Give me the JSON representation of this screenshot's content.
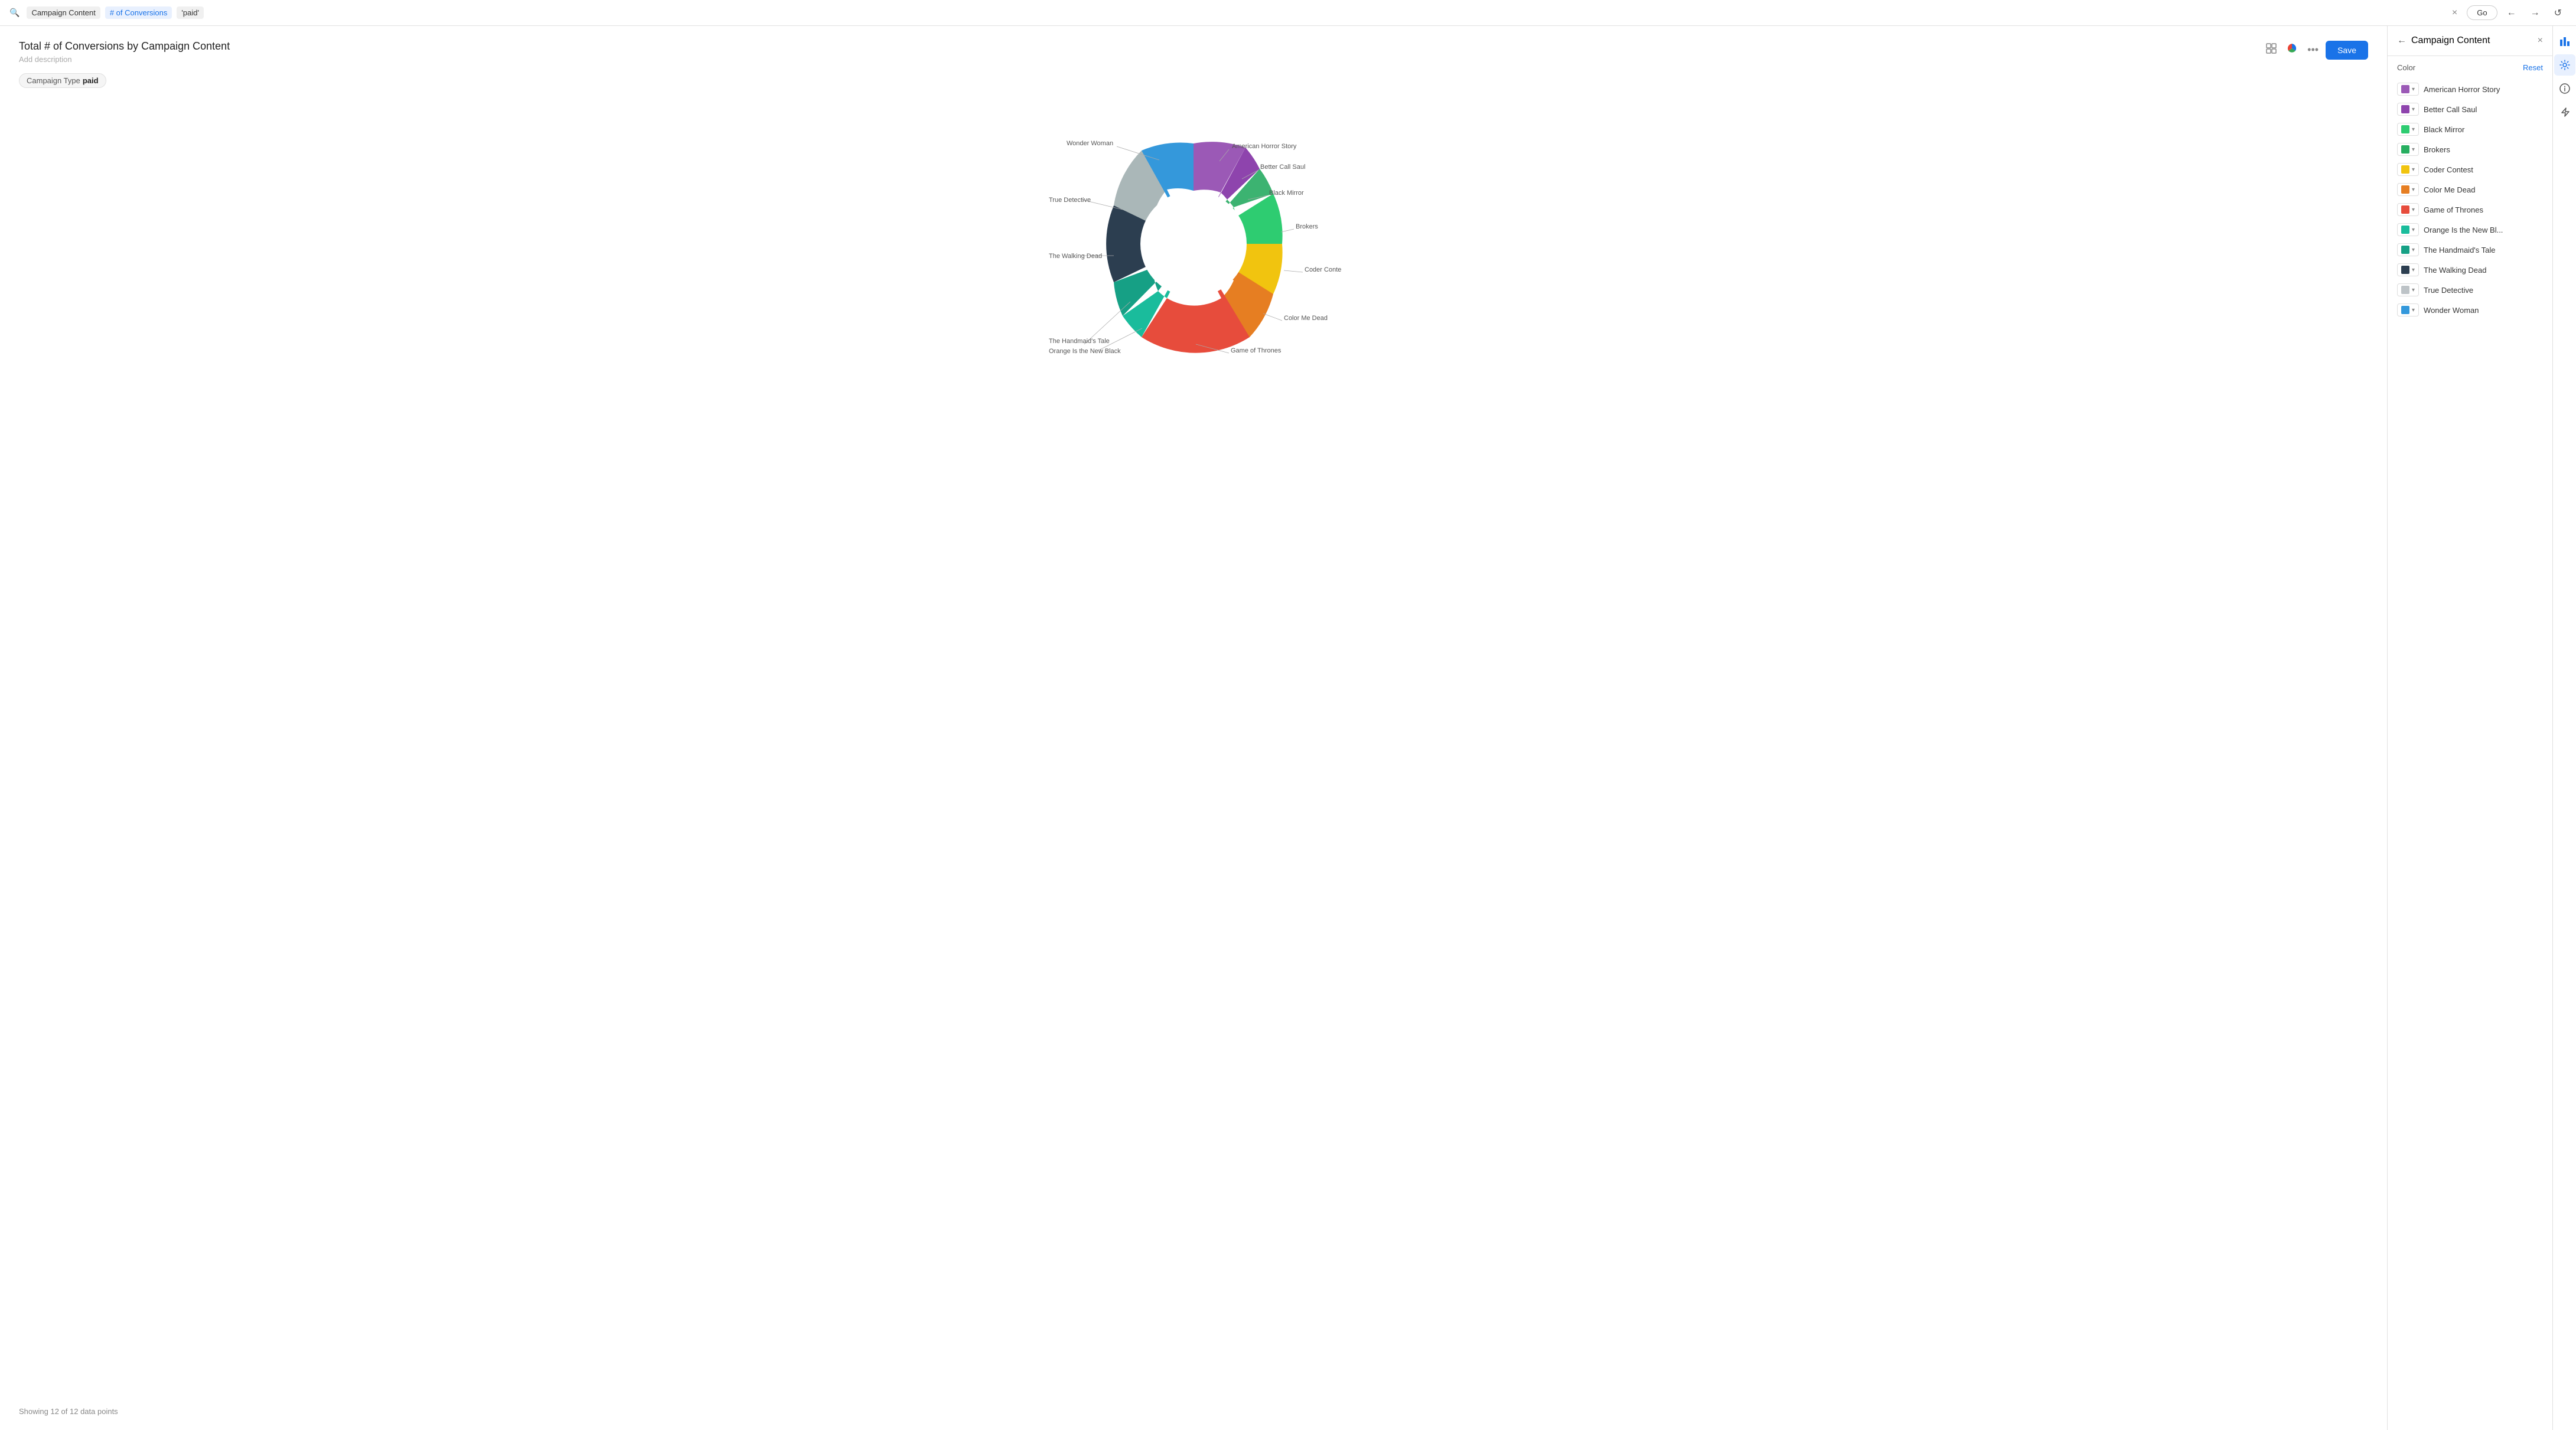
{
  "topbar": {
    "search_icon": "🔍",
    "tags": [
      {
        "label": "Campaign Content",
        "active": false
      },
      {
        "label": "# of Conversions",
        "active": true
      },
      {
        "label": "'paid'",
        "active": false
      }
    ],
    "close_label": "×",
    "go_label": "Go",
    "back_label": "←",
    "forward_label": "→",
    "refresh_label": "↺"
  },
  "chart": {
    "title": "Total # of Conversions by Campaign Content",
    "subtitle": "Add description",
    "save_label": "Save",
    "filter_label": "Campaign Type",
    "filter_value": "paid",
    "data_points_note": "Showing 12 of 12 data points",
    "segments": [
      {
        "label": "American Horror Story",
        "color": "#9b59b6",
        "pct": 9,
        "angle_start": -15,
        "angle_end": 47
      },
      {
        "label": "Better Call Saul",
        "color": "#8e44ad",
        "pct": 4,
        "angle_start": 47,
        "angle_end": 68
      },
      {
        "label": "Black Mirror",
        "color": "#27ae60",
        "pct": 4,
        "angle_start": 68,
        "angle_end": 89
      },
      {
        "label": "Brokers",
        "color": "#2ecc71",
        "pct": 8,
        "angle_start": 89,
        "angle_end": 138
      },
      {
        "label": "Coder Contest",
        "color": "#f1c40f",
        "pct": 5,
        "angle_start": 138,
        "angle_end": 168
      },
      {
        "label": "Color Me Dead",
        "color": "#e67e22",
        "pct": 8,
        "angle_start": 168,
        "angle_end": 213
      },
      {
        "label": "Game of Thrones",
        "color": "#e74c3c",
        "pct": 18,
        "angle_start": 213,
        "angle_end": 318
      },
      {
        "label": "Orange Is the New Black",
        "color": "#1abc9c",
        "pct": 3,
        "angle_start": 318,
        "angle_end": 334
      },
      {
        "label": "The Handmaid's Tale",
        "color": "#16a085",
        "pct": 3,
        "angle_start": 334,
        "angle_end": 352
      },
      {
        "label": "The Walking Dead",
        "color": "#2c3e50",
        "pct": 10,
        "angle_start": 352,
        "angle_end": 415
      },
      {
        "label": "True Detective",
        "color": "#bdc3c7",
        "pct": 12,
        "angle_start": 415,
        "angle_end": 490
      },
      {
        "label": "Wonder Woman",
        "color": "#3498db",
        "pct": 16,
        "angle_start": 490,
        "angle_end": 585
      }
    ]
  },
  "panel": {
    "title": "Campaign Content",
    "back_label": "←",
    "close_label": "×",
    "color_section_label": "Color",
    "reset_label": "Reset",
    "items": [
      {
        "label": "American Horror Story",
        "color": "#9b59b6"
      },
      {
        "label": "Better Call Saul",
        "color": "#8e44ad"
      },
      {
        "label": "Black Mirror",
        "color": "#2ecc71"
      },
      {
        "label": "Brokers",
        "color": "#27ae60"
      },
      {
        "label": "Coder Contest",
        "color": "#f1c40f"
      },
      {
        "label": "Color Me Dead",
        "color": "#e67e22"
      },
      {
        "label": "Game of Thrones",
        "color": "#e74c3c"
      },
      {
        "label": "Orange Is the New Bl...",
        "color": "#1abc9c"
      },
      {
        "label": "The Handmaid's Tale",
        "color": "#16a085"
      },
      {
        "label": "The Walking Dead",
        "color": "#2c3e50"
      },
      {
        "label": "True Detective",
        "color": "#bdc3c7"
      },
      {
        "label": "Wonder Woman",
        "color": "#3498db"
      }
    ]
  },
  "icon_sidebar": {
    "bar_chart_icon": "📊",
    "gear_icon": "⚙",
    "info_icon": "ℹ",
    "bolt_icon": "⚡"
  }
}
